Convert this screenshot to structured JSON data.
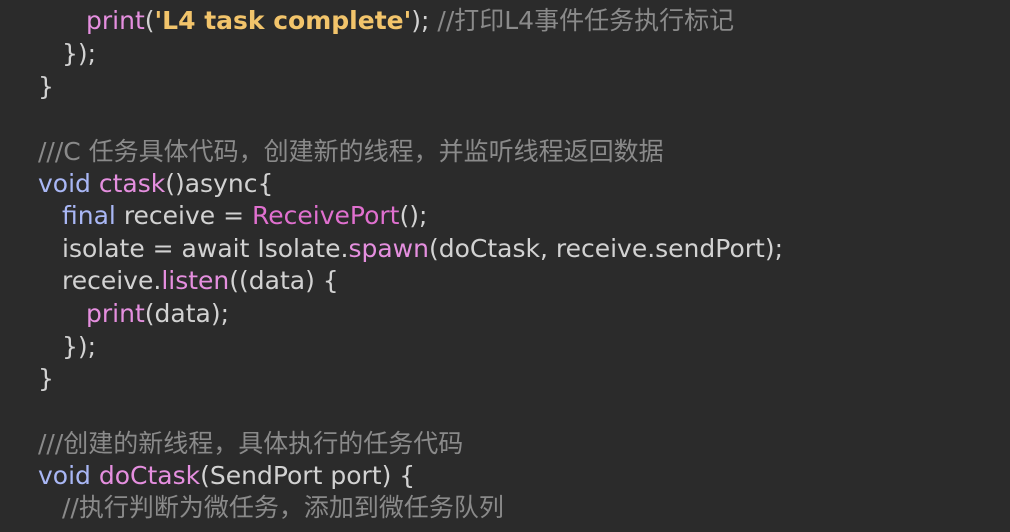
{
  "theme": {
    "background": "#2b2b2b",
    "plain": "#d2d2d2",
    "keyword": "#a9b7f5",
    "function": "#e58fdf",
    "class": "#e070cf",
    "string": "#f2c46b",
    "comment": "#8a8a8a"
  },
  "code": {
    "lines": [
      {
        "tokens": [
          {
            "t": "print",
            "k": "func"
          },
          {
            "t": "(",
            "k": "plain"
          },
          {
            "t": "'L4 task complete'",
            "k": "string"
          },
          {
            "t": "); ",
            "k": "plain"
          },
          {
            "t": "//打印L4事件任务执行标记",
            "k": "comment"
          }
        ]
      },
      {
        "tokens": [
          {
            "t": "});",
            "k": "plain"
          }
        ]
      },
      {
        "tokens": [
          {
            "t": "}",
            "k": "plain"
          }
        ]
      },
      {
        "tokens": []
      },
      {
        "tokens": [
          {
            "t": "///C 任务具体代码，创建新的线程，并监听线程返回数据",
            "k": "comment"
          }
        ]
      },
      {
        "tokens": [
          {
            "t": "void ",
            "k": "keyword"
          },
          {
            "t": "ctask",
            "k": "func"
          },
          {
            "t": "()async{",
            "k": "plain"
          }
        ]
      },
      {
        "tokens": [
          {
            "t": "final ",
            "k": "keyword"
          },
          {
            "t": "receive = ",
            "k": "plain"
          },
          {
            "t": "ReceivePort",
            "k": "class"
          },
          {
            "t": "();",
            "k": "plain"
          }
        ]
      },
      {
        "tokens": [
          {
            "t": "isolate = await Isolate.",
            "k": "plain"
          },
          {
            "t": "spawn",
            "k": "func"
          },
          {
            "t": "(doCtask, receive.sendPort);",
            "k": "plain"
          }
        ]
      },
      {
        "tokens": [
          {
            "t": "receive.",
            "k": "plain"
          },
          {
            "t": "listen",
            "k": "func"
          },
          {
            "t": "((data) {",
            "k": "plain"
          }
        ]
      },
      {
        "tokens": [
          {
            "t": "print",
            "k": "func"
          },
          {
            "t": "(data);",
            "k": "plain"
          }
        ]
      },
      {
        "tokens": [
          {
            "t": "});",
            "k": "plain"
          }
        ]
      },
      {
        "tokens": [
          {
            "t": "}",
            "k": "plain"
          }
        ]
      },
      {
        "tokens": []
      },
      {
        "tokens": [
          {
            "t": "///创建的新线程，具体执行的任务代码",
            "k": "comment"
          }
        ]
      },
      {
        "tokens": [
          {
            "t": "void ",
            "k": "keyword"
          },
          {
            "t": "doCtask",
            "k": "func"
          },
          {
            "t": "(SendPort port) {",
            "k": "plain"
          }
        ]
      },
      {
        "tokens": [
          {
            "t": "//执行判断为微任务，添加到微任务队列",
            "k": "comment"
          }
        ]
      }
    ]
  }
}
